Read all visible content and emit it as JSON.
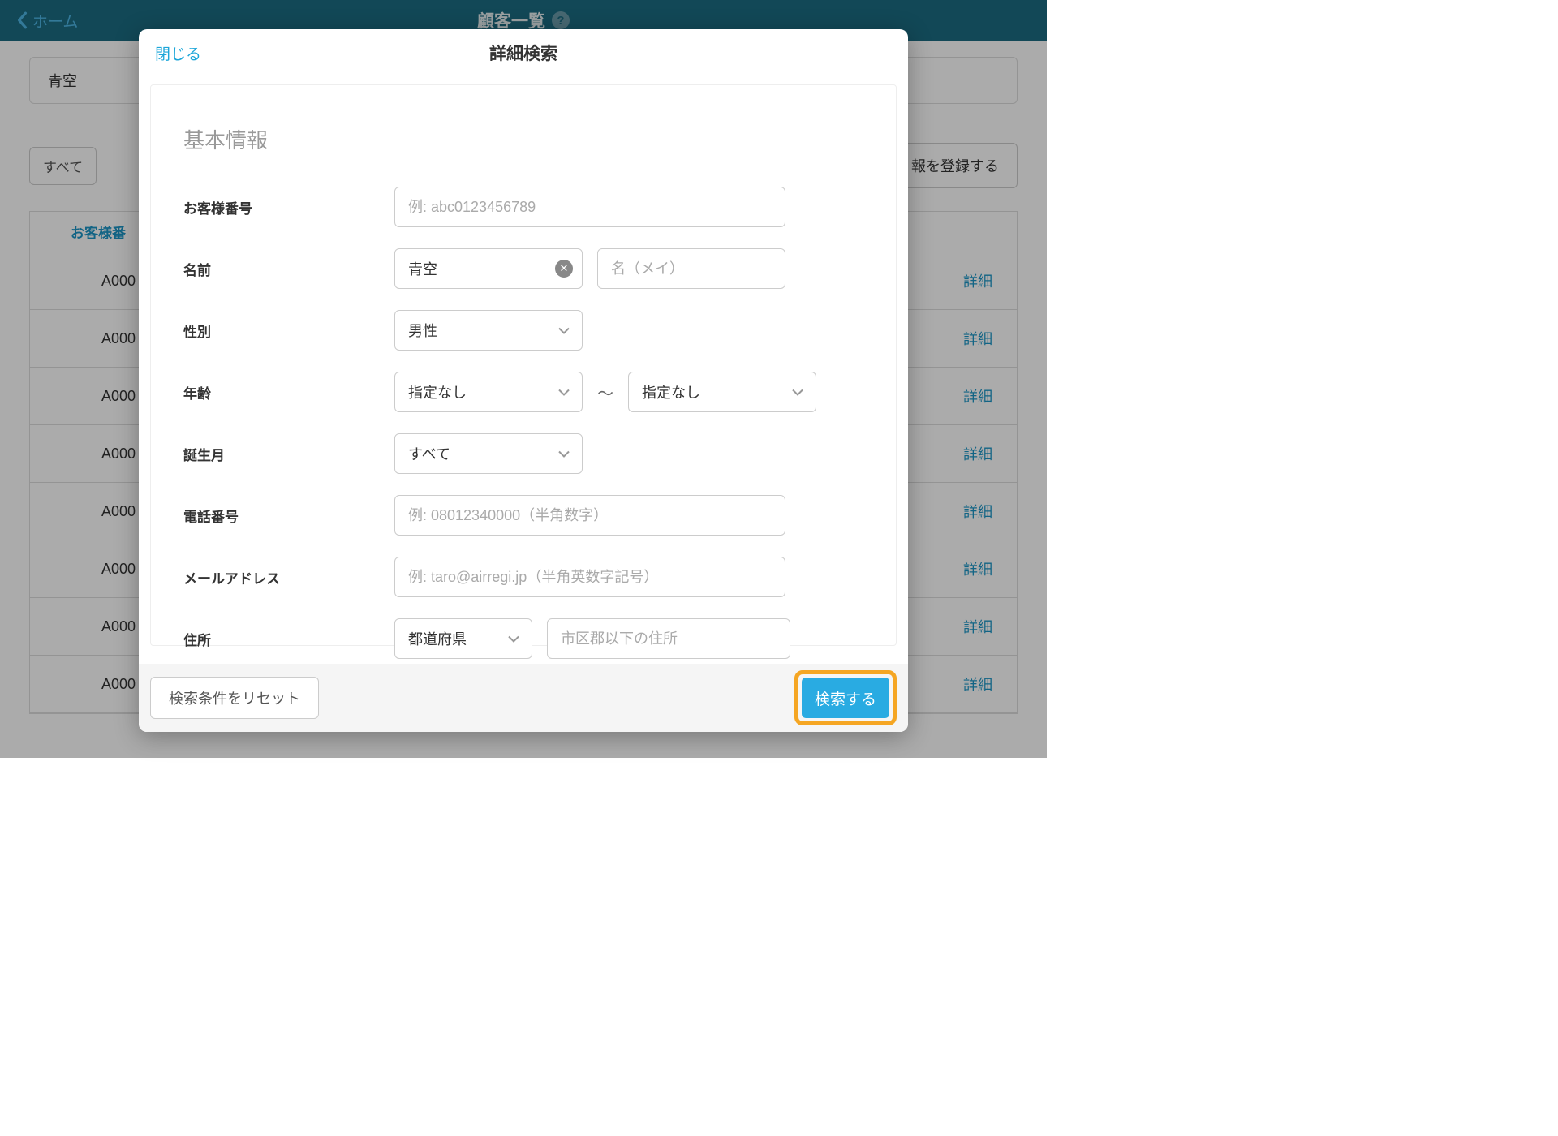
{
  "header": {
    "back_label": "ホーム",
    "title": "顧客一覧"
  },
  "background": {
    "search_value": "青空",
    "filter_all": "すべて",
    "register_button": "報を登録する",
    "column_header": "お客様番",
    "row_prefix": "A000",
    "detail_label": "詳細"
  },
  "modal": {
    "close_label": "閉じる",
    "title": "詳細検索",
    "section_title": "基本情報",
    "fields": {
      "customer_number": {
        "label": "お客様番号",
        "placeholder": "例: abc0123456789"
      },
      "name": {
        "label": "名前",
        "surname_value": "青空",
        "given_placeholder": "名（メイ）"
      },
      "gender": {
        "label": "性別",
        "value": "男性"
      },
      "age": {
        "label": "年齢",
        "from_value": "指定なし",
        "to_value": "指定なし",
        "separator": "〜"
      },
      "birth_month": {
        "label": "誕生月",
        "value": "すべて"
      },
      "phone": {
        "label": "電話番号",
        "placeholder": "例: 08012340000（半角数字）"
      },
      "email": {
        "label": "メールアドレス",
        "placeholder": "例: taro@airregi.jp（半角英数字記号）"
      },
      "address": {
        "label": "住所",
        "pref_value": "都道府県",
        "city_placeholder": "市区郡以下の住所"
      }
    },
    "reset_button": "検索条件をリセット",
    "search_button": "検索する"
  }
}
